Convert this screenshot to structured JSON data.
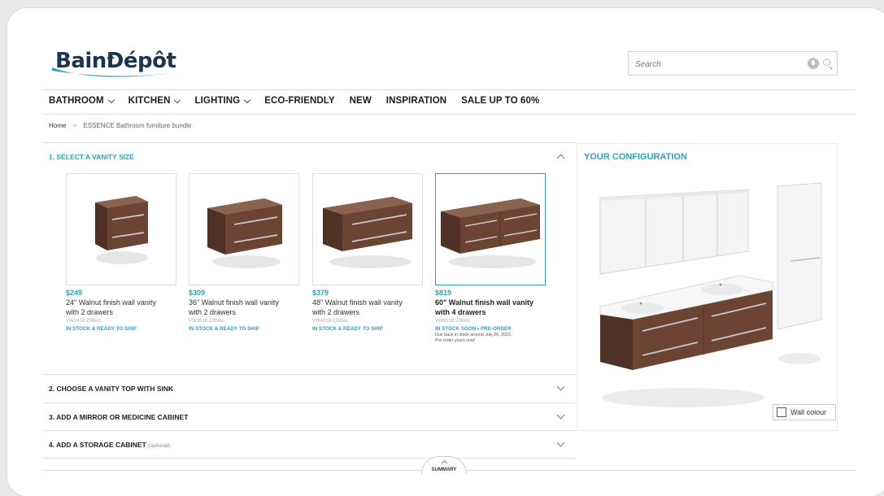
{
  "brand": {
    "name": "BainDépôt"
  },
  "search": {
    "placeholder": "Search"
  },
  "nav": [
    {
      "label": "BATHROOM",
      "has_dropdown": true
    },
    {
      "label": "KITCHEN",
      "has_dropdown": true
    },
    {
      "label": "LIGHTING",
      "has_dropdown": true
    },
    {
      "label": "ECO-FRIENDLY",
      "has_dropdown": false
    },
    {
      "label": "NEW",
      "has_dropdown": false
    },
    {
      "label": "INSPIRATION",
      "has_dropdown": false
    },
    {
      "label": "SALE UP TO 60%",
      "has_dropdown": false
    }
  ],
  "breadcrumb": {
    "home": "Home",
    "separator": ">",
    "current": "ESSENCE Bathroom furniture bundle"
  },
  "steps": [
    {
      "title": "1. SELECT A VANITY SIZE",
      "optional": "",
      "expanded": true
    },
    {
      "title": "2. CHOOSE A VANITY TOP WITH SINK",
      "optional": "",
      "expanded": false
    },
    {
      "title": "3. ADD A MIRROR OR MEDICINE CABINET",
      "optional": "",
      "expanded": false
    },
    {
      "title": "4. ADD A STORAGE CABINET",
      "optional": "(optional)",
      "expanded": false
    }
  ],
  "products": [
    {
      "price": "$249",
      "name_line1": "24\" Walnut finish wall vanity",
      "name_line2": "with 2 drawers",
      "sku": "VW2418-23WAL",
      "stock": "IN STOCK & READY TO SHIP",
      "note_line1": "",
      "note_line2": "",
      "selected": false
    },
    {
      "price": "$309",
      "name_line1": "36\" Walnut finish wall vanity",
      "name_line2": "with 2 drawers",
      "sku": "VW3618-23WAL",
      "stock": "IN STOCK & READY TO SHIP",
      "note_line1": "",
      "note_line2": "",
      "selected": false
    },
    {
      "price": "$379",
      "name_line1": "48\" Walnut finish wall vanity",
      "name_line2": "with 2 drawers",
      "sku": "VW4818-23WAL",
      "stock": "IN STOCK & READY TO SHIP",
      "note_line1": "",
      "note_line2": "",
      "selected": false
    },
    {
      "price": "$819",
      "name_line1": "60\" Walnut finish wall vanity",
      "name_line2": "with 4 drawers",
      "sku": "VW6018-23WAL",
      "stock": "IN STOCK SOON • PRE-ORDER",
      "note_line1": "Due back in stock around July 26, 2023.",
      "note_line2": "Pre-order yours now!",
      "selected": true
    }
  ],
  "configuration": {
    "title": "YOUR CONFIGURATION",
    "wall_colour_label": "Wall colour"
  },
  "summary": {
    "label": "SUMMARY"
  },
  "colors": {
    "accent": "#2aa3b8",
    "walnut": "#6b4433",
    "brand_navy": "#1a3550",
    "brand_wave": "#2aa3b8"
  }
}
